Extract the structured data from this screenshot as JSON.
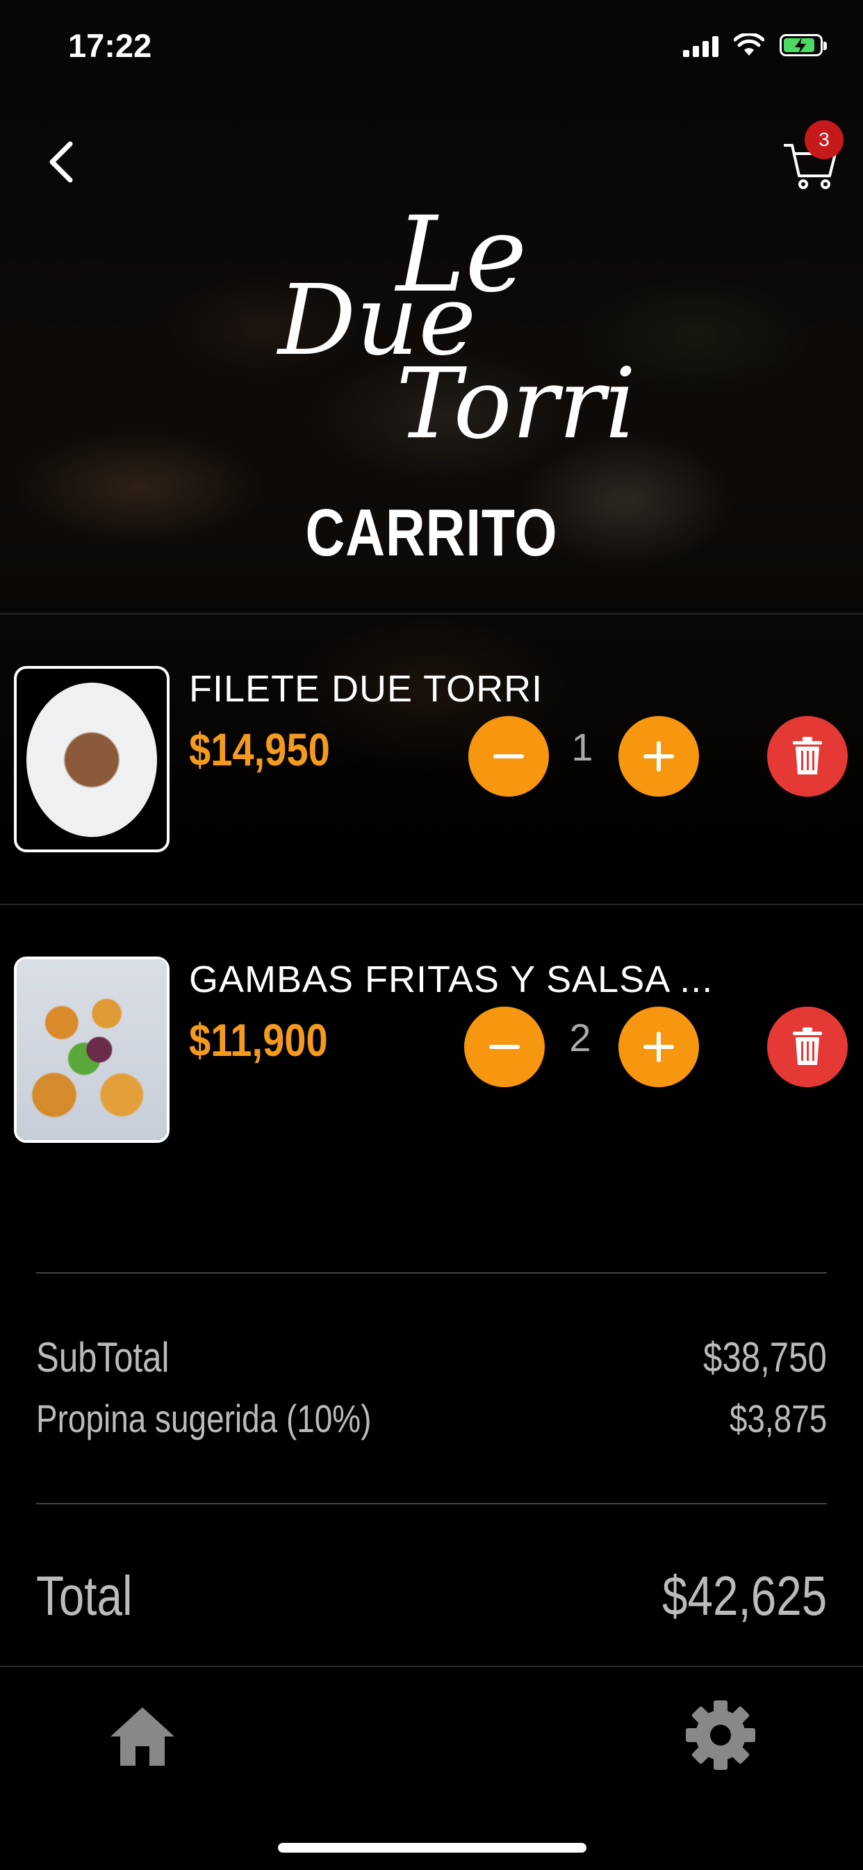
{
  "status_bar": {
    "time": "17:22"
  },
  "header": {
    "cart_count": "3",
    "logo_line1": "Le",
    "logo_line2": "Due",
    "logo_line3": "Torri",
    "title": "CARRITO"
  },
  "cart": {
    "items": [
      {
        "name": "FILETE DUE TORRI",
        "price": "$14,950",
        "quantity": "1"
      },
      {
        "name": "GAMBAS FRITAS Y SALSA ...",
        "price": "$11,900",
        "quantity": "2"
      }
    ]
  },
  "summary": {
    "subtotal_label": "SubTotal",
    "subtotal_value": "$38,750",
    "tip_label": "Propina sugerida (10%)",
    "tip_value": "$3,875",
    "total_label": "Total",
    "total_value": "$42,625"
  },
  "colors": {
    "accent": "#f7960f",
    "price": "#f49b1e",
    "delete": "#e53935",
    "badge": "#c6191c"
  }
}
